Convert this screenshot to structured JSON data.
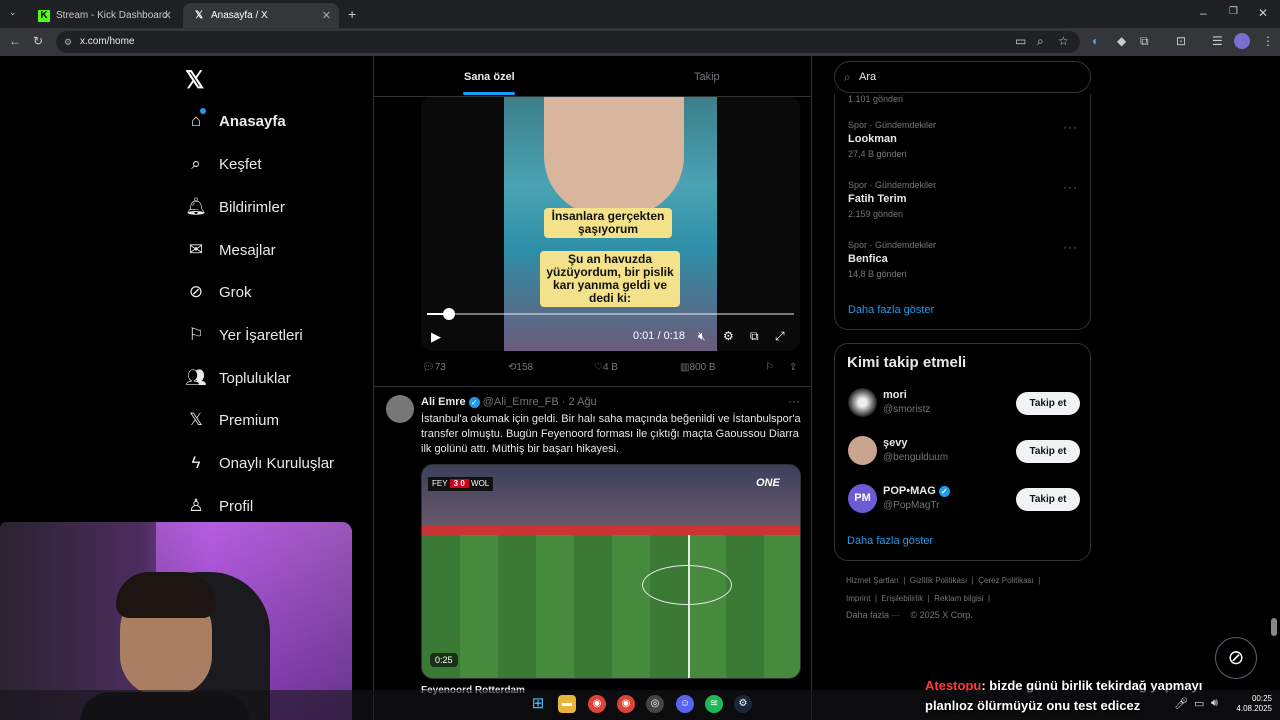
{
  "browser": {
    "tabs": [
      {
        "title": "Stream - Kick Dashboard",
        "active": false
      },
      {
        "title": "Anasayfa / X",
        "active": true
      }
    ],
    "url": "x.com/home"
  },
  "nav": {
    "items": [
      {
        "label": "Anasayfa",
        "icon": "home-icon",
        "glyph": "⌂",
        "bold": true
      },
      {
        "label": "Keşfet",
        "icon": "search-icon",
        "glyph": "⌕"
      },
      {
        "label": "Bildirimler",
        "icon": "bell-icon",
        "glyph": "🔔︎"
      },
      {
        "label": "Mesajlar",
        "icon": "mail-icon",
        "glyph": "✉"
      },
      {
        "label": "Grok",
        "icon": "grok-icon",
        "glyph": "⊘"
      },
      {
        "label": "Yer İşaretleri",
        "icon": "bookmark-icon",
        "glyph": "⚐"
      },
      {
        "label": "Topluluklar",
        "icon": "communities-icon",
        "glyph": "👥︎"
      },
      {
        "label": "Premium",
        "icon": "x-logo-icon",
        "glyph": "𝕏"
      },
      {
        "label": "Onaylı Kuruluşlar",
        "icon": "lightning-icon",
        "glyph": "ϟ"
      },
      {
        "label": "Profil",
        "icon": "person-icon",
        "glyph": "♙"
      }
    ]
  },
  "timeline": {
    "tabs": {
      "for_you": "Sana özel",
      "following": "Takip"
    },
    "video1": {
      "caption1": "İnsanlara gerçekten şaşıyorum",
      "caption2": "Şu an havuzda yüzüyordum, bir pislik karı yanıma geldi ve dedi ki:",
      "time": "0:01 / 0:18",
      "progress": 0.06
    },
    "tweet1_actions": {
      "replies": "73",
      "reposts": "158",
      "likes": "4 B",
      "views": "800 B"
    },
    "tweet2": {
      "author": "Ali Emre",
      "handle": "@Ali_Emre_FB",
      "date": "2 Ağu",
      "text": "İstanbul'a okumak için geldi. Bir halı saha maçında beğenildi ve İstanbulspor'a transfer olmuştu. Bugün Feyenoord forması ile çıktığı maçta Gaoussou Diarra ilk golünü attı. Müthiş bir başarı hikayesi.",
      "video_duration": "0:25",
      "scoreboard": {
        "home": "FEY",
        "score": "3  0",
        "away": "WOL",
        "overlay": "ONE"
      },
      "next_preview": "Feyenoord Rotterdam"
    }
  },
  "right": {
    "search_placeholder": "Ara",
    "trend_top_count": "1.101 gönderi",
    "trends": [
      {
        "category": "Spor · Gündemdekiler",
        "name": "Lookman",
        "count": "27,4 B gönderi"
      },
      {
        "category": "Spor · Gündemdekiler",
        "name": "Fatih Terim",
        "count": "2.159 gönderi"
      },
      {
        "category": "Spor · Gündemdekiler",
        "name": "Benfica",
        "count": "14,8 B gönderi"
      }
    ],
    "show_more": "Daha fazla göster",
    "who_title": "Kimi takip etmeli",
    "who": [
      {
        "name": "mori",
        "handle": "@smoristz",
        "verified": false
      },
      {
        "name": "şevy",
        "handle": "@bengulduum",
        "verified": false
      },
      {
        "name": "POP•MAG",
        "handle": "@PopMagTr",
        "verified": true
      }
    ],
    "follow_label": "Takip et",
    "footer": {
      "row1": [
        "Hizmet Şartları",
        "Gizlilik Politikası",
        "Çerez Politikası"
      ],
      "row2": [
        "Imprint",
        "Erişilebilirlik",
        "Reklam bilgisi"
      ],
      "more": "Daha fazla ···",
      "copyright": "© 2025 X Corp."
    }
  },
  "overlay": {
    "chat_user": "Atestopu",
    "chat_line1": ": bizde günü birlik tekirdağ yapmayı",
    "chat_line2": "planlıoz ölürmüyüz onu test edicez"
  },
  "taskbar": {
    "time": "00:25",
    "date": "4.08.2025"
  },
  "colors": {
    "accent": "#1d9bf0",
    "chat_user": "#ff3b3b",
    "kick_green": "#53fc18"
  }
}
